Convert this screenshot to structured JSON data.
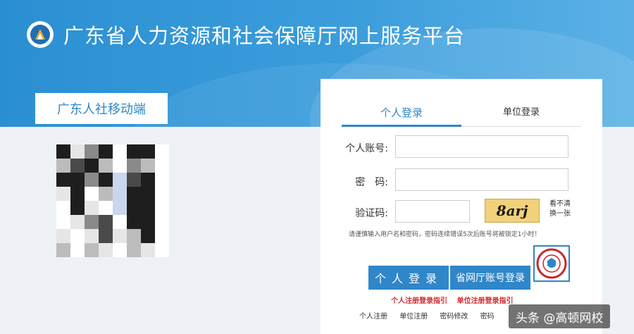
{
  "header": {
    "title": "广东省人力资源和社会保障厅网上服务平台",
    "logo_icon": "gd-hrss-logo-icon"
  },
  "mobile": {
    "tab_label": "广东人社移动端",
    "qr_icon": "qr-code-icon"
  },
  "login": {
    "tabs": [
      {
        "label": "个人登录",
        "active": true
      },
      {
        "label": "单位登录",
        "active": false
      }
    ],
    "account_label": "个人账号:",
    "account_value": "",
    "password_label": "密　码:",
    "password_value": "",
    "captcha_label": "验证码:",
    "captcha_value": "",
    "captcha_text": "8arj",
    "refresh_line1": "看不清",
    "refresh_line2": "换一张",
    "notice": "请谨慎输入用户名和密码，密码连续错误5次后账号将被锁定1小时！",
    "login_button": "个人登录",
    "provincial_button": "省网厅账号登录",
    "guide_personal": "个人注册登录指引",
    "guide_unit": "单位注册登录指引",
    "links": [
      "个人注册",
      "单位注册",
      "密码修改",
      "密码"
    ]
  },
  "watermark": "头条 @高顿网校",
  "colors": {
    "brand_blue": "#2f86c8",
    "banner_blue": "#3c9ddc",
    "guide_red": "#d3262b",
    "captcha_bg": "#f1d27a"
  }
}
